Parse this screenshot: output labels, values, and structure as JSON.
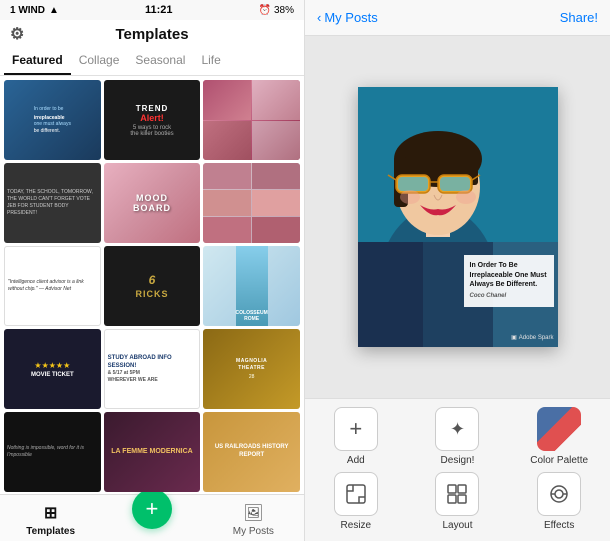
{
  "app": {
    "title": "Templates",
    "status": {
      "carrier": "1 WIND",
      "time": "11:21",
      "battery": "38%"
    }
  },
  "left": {
    "tabs": [
      {
        "id": "featured",
        "label": "Featured",
        "active": true
      },
      {
        "id": "collage",
        "label": "Collage",
        "active": false
      },
      {
        "id": "seasonal",
        "label": "Seasonal",
        "active": false
      },
      {
        "id": "life",
        "label": "Life",
        "active": false
      }
    ],
    "templates": [
      {
        "id": 1,
        "label": "In order to be irreplaceable one must always be different"
      },
      {
        "id": 2,
        "label": "TREND ALERT"
      },
      {
        "id": 3,
        "label": ""
      },
      {
        "id": 4,
        "label": "5 ways to rock the killer booties"
      },
      {
        "id": 5,
        "label": "MOOD BOARD"
      },
      {
        "id": 6,
        "label": ""
      },
      {
        "id": 7,
        "label": "Intelligence client advisor..."
      },
      {
        "id": 8,
        "label": "6 TRICKS"
      },
      {
        "id": 9,
        "label": ""
      },
      {
        "id": 10,
        "label": "★★★★★ MOVIE TICKET"
      },
      {
        "id": 11,
        "label": "STUDY ABROAD INFO SESSION"
      },
      {
        "id": 12,
        "label": "MAGNOLIA THEATRE"
      },
      {
        "id": 13,
        "label": ""
      },
      {
        "id": 14,
        "label": "LA FEMME MODERNICA"
      },
      {
        "id": 15,
        "label": "US RAILROADS HISTORY REPORT"
      }
    ],
    "nav": [
      {
        "id": "templates",
        "label": "Templates",
        "active": true
      },
      {
        "id": "add",
        "label": "+",
        "isFab": true
      },
      {
        "id": "myposts",
        "label": "My Posts",
        "active": false
      }
    ]
  },
  "right": {
    "header": {
      "back_label": "My Posts",
      "share_label": "Share!"
    },
    "poster": {
      "quote": "In Order To Be Irreplaceable One Must Always Be Different.",
      "attribution": "Coco Chanel",
      "badge": "Adobe Spark"
    },
    "tools": [
      {
        "id": "add",
        "label": "Add",
        "icon": "+"
      },
      {
        "id": "design",
        "label": "Design!",
        "icon": "✦"
      },
      {
        "id": "color_palette",
        "label": "Color Palette",
        "icon": ""
      },
      {
        "id": "resize",
        "label": "Resize",
        "icon": "⊡"
      },
      {
        "id": "layout",
        "label": "Layout",
        "icon": "▦"
      },
      {
        "id": "effects",
        "label": "Effects",
        "icon": "◎"
      }
    ]
  }
}
